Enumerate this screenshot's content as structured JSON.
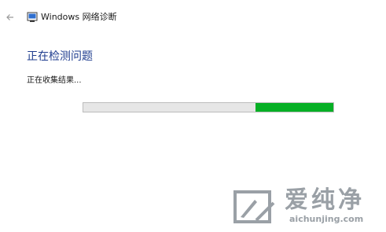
{
  "window": {
    "title": "Windows 网络诊断"
  },
  "icons": {
    "back": "back-arrow-icon",
    "app": "network-diagnostics-icon",
    "watermark_logo": "aichunjing-logo-icon"
  },
  "main": {
    "heading": "正在检测问题",
    "status": "正在收集结果...",
    "progress": {
      "style": "marquee",
      "segment_start": 0.69,
      "segment_end": 1.0
    }
  },
  "watermark": {
    "brand": "爱纯净",
    "url": "aichunjing.com"
  },
  "colors": {
    "heading": "#1f3d8f",
    "progress_fill": "#06b025",
    "progress_track": "#e6e6e6",
    "watermark": "#9aa0a6"
  }
}
